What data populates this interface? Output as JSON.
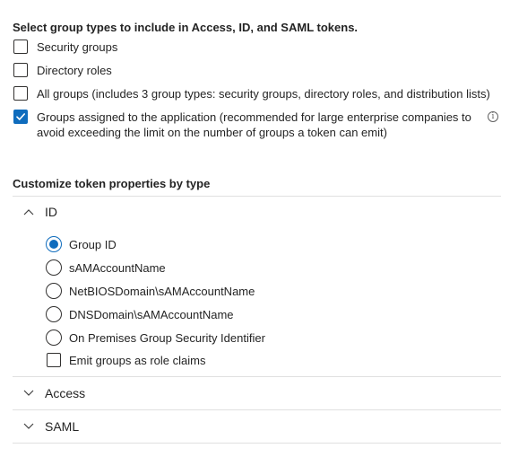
{
  "group_types": {
    "heading": "Select group types to include in Access, ID, and SAML tokens.",
    "options": [
      {
        "label": "Security groups",
        "checked": false
      },
      {
        "label": "Directory roles",
        "checked": false
      },
      {
        "label": "All groups (includes 3 group types: security groups, directory roles, and distribution lists)",
        "checked": false
      },
      {
        "label_line1": "Groups assigned to the application (recommended for large enterprise companies to",
        "label_line2": "avoid exceeding the limit on the number of groups a token can emit)",
        "checked": true
      }
    ],
    "info_icon": "i"
  },
  "customize": {
    "heading": "Customize token properties by type",
    "sections": [
      {
        "label": "ID",
        "expanded": true,
        "radios": [
          {
            "label": "Group ID",
            "selected": true
          },
          {
            "label": "sAMAccountName",
            "selected": false
          },
          {
            "label": "NetBIOSDomain\\sAMAccountName",
            "selected": false
          },
          {
            "label": "DNSDomain\\sAMAccountName",
            "selected": false
          },
          {
            "label": "On Premises Group Security Identifier",
            "selected": false
          }
        ],
        "emit_checkbox": {
          "label": "Emit groups as role claims",
          "checked": false
        }
      },
      {
        "label": "Access",
        "expanded": false
      },
      {
        "label": "SAML",
        "expanded": false
      }
    ]
  },
  "colors": {
    "accent": "#0f6cbd",
    "border": "#323130",
    "divider": "#e0e0e0",
    "text": "#242424"
  }
}
